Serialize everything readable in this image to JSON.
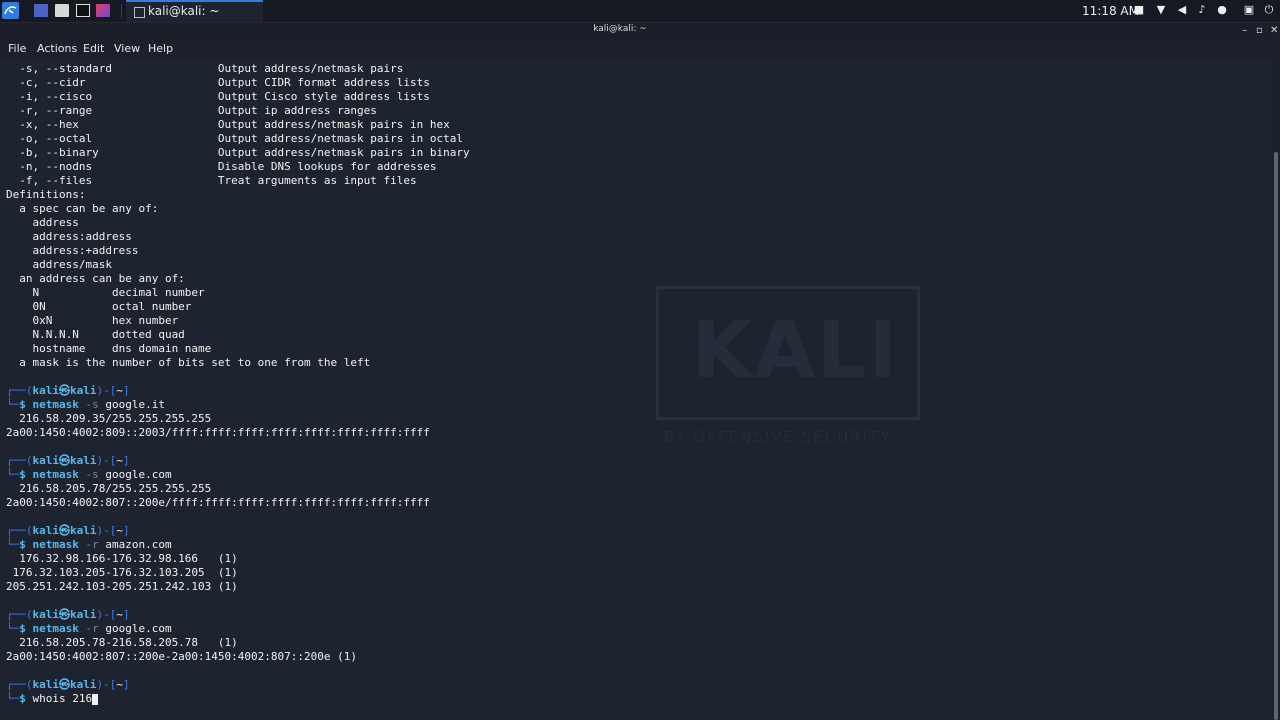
{
  "taskbar": {
    "active_task": "kali@kali: ~",
    "clock": "11:18 AM"
  },
  "window": {
    "title": "kali@kali: ~"
  },
  "menu": {
    "items": [
      "File",
      "Actions",
      "Edit",
      "View",
      "Help"
    ]
  },
  "terminal": {
    "help_lines": [
      "  -s, --standard                Output address/netmask pairs",
      "  -c, --cidr                    Output CIDR format address lists",
      "  -i, --cisco                   Output Cisco style address lists",
      "  -r, --range                   Output ip address ranges",
      "  -x, --hex                     Output address/netmask pairs in hex",
      "  -o, --octal                   Output address/netmask pairs in octal",
      "  -b, --binary                  Output address/netmask pairs in binary",
      "  -n, --nodns                   Disable DNS lookups for addresses",
      "  -f, --files                   Treat arguments as input files",
      "Definitions:",
      "  a spec can be any of:",
      "    address",
      "    address:address",
      "    address:+address",
      "    address/mask",
      "  an address can be any of:",
      "    N           decimal number",
      "    0N          octal number",
      "    0xN         hex number",
      "    N.N.N.N     dotted quad",
      "    hostname    dns domain name",
      "  a mask is the number of bits set to one from the left"
    ],
    "prompt_top": "┌──(",
    "prompt_user": "kali㉿kali",
    "prompt_mid": ")-[",
    "prompt_dir": "~",
    "prompt_end": "]",
    "prompt_bottom": "└─",
    "prompt_symbol": "$",
    "sessions": [
      {
        "cmd": "netmask",
        "flag": "-s",
        "arg": "google.it",
        "output": [
          "  216.58.209.35/255.255.255.255",
          "2a00:1450:4002:809::2003/ffff:ffff:ffff:ffff:ffff:ffff:ffff:ffff"
        ]
      },
      {
        "cmd": "netmask",
        "flag": "-s",
        "arg": "google.com",
        "output": [
          "  216.58.205.78/255.255.255.255",
          "2a00:1450:4002:807::200e/ffff:ffff:ffff:ffff:ffff:ffff:ffff:ffff"
        ]
      },
      {
        "cmd": "netmask",
        "flag": "-r",
        "arg": "amazon.com",
        "output": [
          "  176.32.98.166-176.32.98.166   (1)",
          " 176.32.103.205-176.32.103.205  (1)",
          "205.251.242.103-205.251.242.103 (1)"
        ]
      },
      {
        "cmd": "netmask",
        "flag": "-r",
        "arg": "google.com",
        "output": [
          "  216.58.205.78-216.58.205.78   (1)",
          "2a00:1450:4002:807::200e-2a00:1450:4002:807::200e (1)"
        ]
      }
    ],
    "current_input": "whois 216",
    "watermark": {
      "logo": "KALI",
      "tagline": "BY OFFENSIVE SECURITY"
    }
  }
}
